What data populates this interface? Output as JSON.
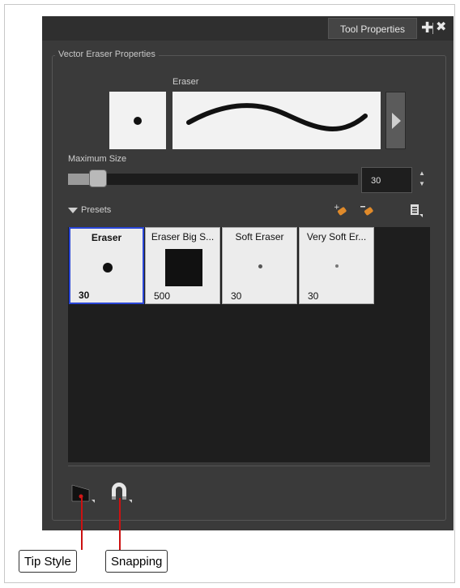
{
  "panel": {
    "tab_label": "Tool Properties",
    "add_icon": "plus-icon",
    "close_icon": "close-icon"
  },
  "group_title": "Vector Eraser Properties",
  "eraser_label": "Eraser",
  "max_size": {
    "label": "Maximum Size",
    "value": "30",
    "slider_fraction": 0.08
  },
  "presets": {
    "label": "Presets",
    "tiles": [
      {
        "name": "Eraser",
        "size": "30",
        "selected": true
      },
      {
        "name": "Eraser Big S...",
        "size": "500",
        "selected": false
      },
      {
        "name": "Soft Eraser",
        "size": "30",
        "selected": false
      },
      {
        "name": "Very Soft Er...",
        "size": "30",
        "selected": false
      }
    ]
  },
  "callouts": {
    "tip_style": "Tip Style",
    "snapping": "Snapping"
  },
  "colors": {
    "panel_bg": "#3a3a3a",
    "selected_border": "#2a46d6",
    "callout_line": "#cc1111"
  }
}
